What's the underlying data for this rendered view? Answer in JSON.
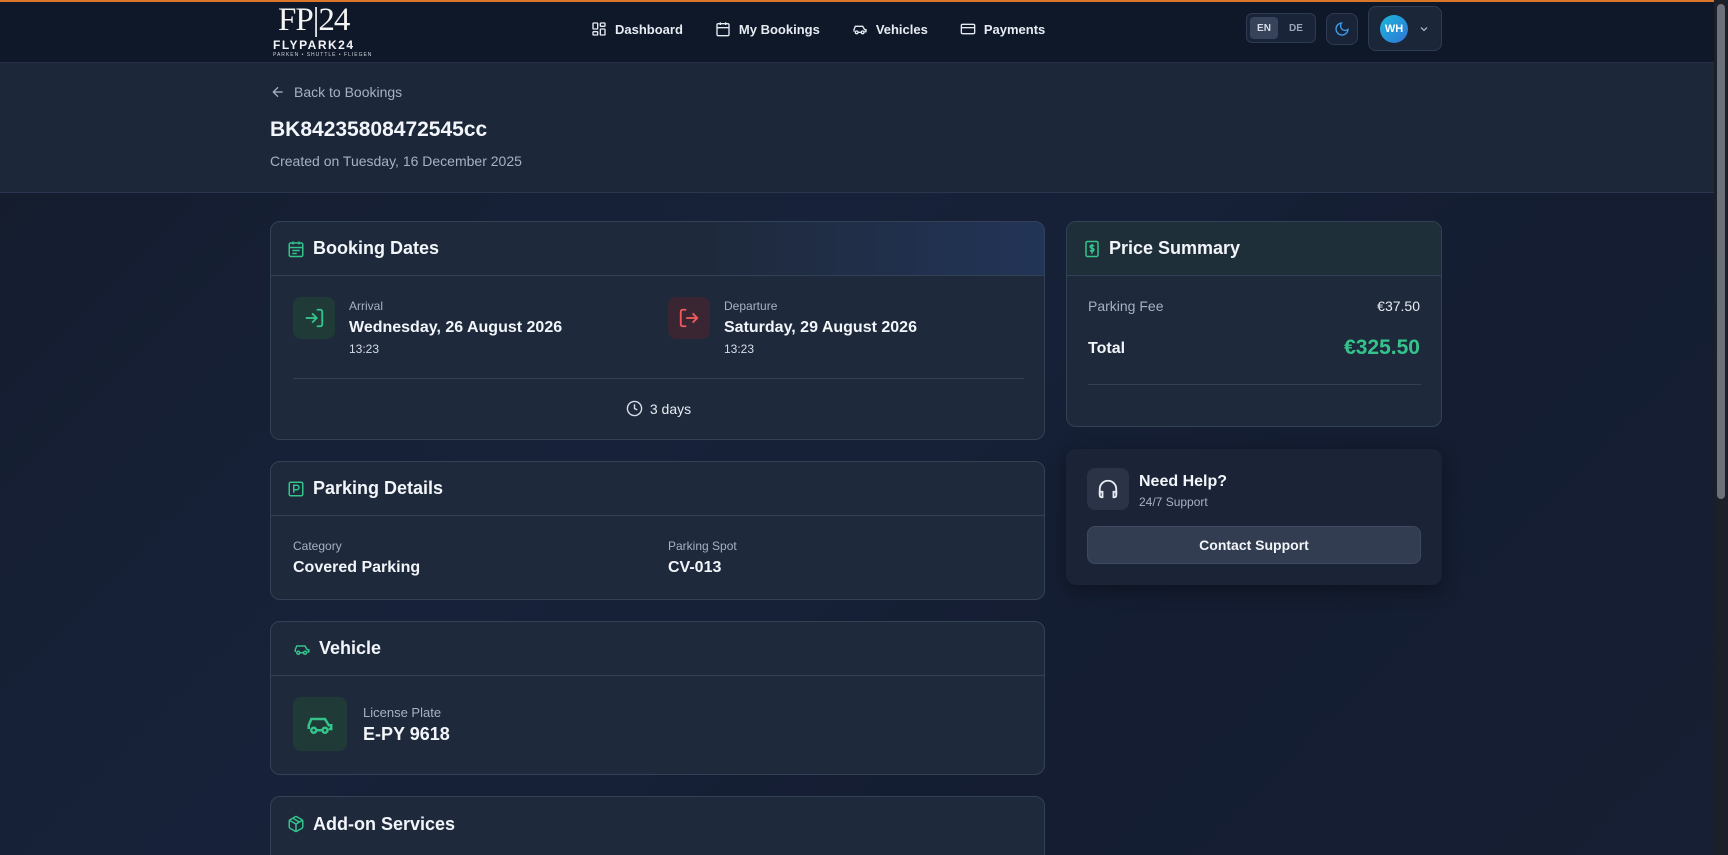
{
  "logo": {
    "mark": "FP|24",
    "brand": "FLYPARK24",
    "tagline": "PARKEN • SHUTTLE • FLIEGEN"
  },
  "nav": {
    "items": [
      {
        "label": "Dashboard",
        "icon": "dashboard-icon"
      },
      {
        "label": "My Bookings",
        "icon": "calendar-icon"
      },
      {
        "label": "Vehicles",
        "icon": "car-icon"
      },
      {
        "label": "Payments",
        "icon": "credit-card-icon"
      }
    ],
    "languages": [
      "EN",
      "DE"
    ],
    "active_language": "EN",
    "user_initials": "WH"
  },
  "header": {
    "back_label": "Back to Bookings",
    "booking_id": "BK84235808472545cc",
    "created": "Created on Tuesday, 16 December 2025"
  },
  "booking_dates": {
    "title": "Booking Dates",
    "arrival": {
      "label": "Arrival",
      "date": "Wednesday, 26 August 2026",
      "time": "13:23"
    },
    "departure": {
      "label": "Departure",
      "date": "Saturday, 29 August 2026",
      "time": "13:23"
    },
    "duration": "3 days"
  },
  "parking_details": {
    "title": "Parking Details",
    "category_label": "Category",
    "category": "Covered Parking",
    "spot_label": "Parking Spot",
    "spot": "CV-013"
  },
  "vehicle": {
    "title": "Vehicle",
    "plate_label": "License Plate",
    "plate": "E-PY 9618"
  },
  "addons": {
    "title": "Add-on Services"
  },
  "price_summary": {
    "title": "Price Summary",
    "fee_label": "Parking Fee",
    "fee": "€37.50",
    "total_label": "Total",
    "total": "€325.50"
  },
  "help": {
    "title": "Need Help?",
    "subtitle": "24/7 Support",
    "button": "Contact Support"
  },
  "colors": {
    "accent_green": "#34c48b",
    "departure_red": "#ef5b5b",
    "nav_bg": "#0f1829",
    "card_bg": "#1e293b"
  }
}
